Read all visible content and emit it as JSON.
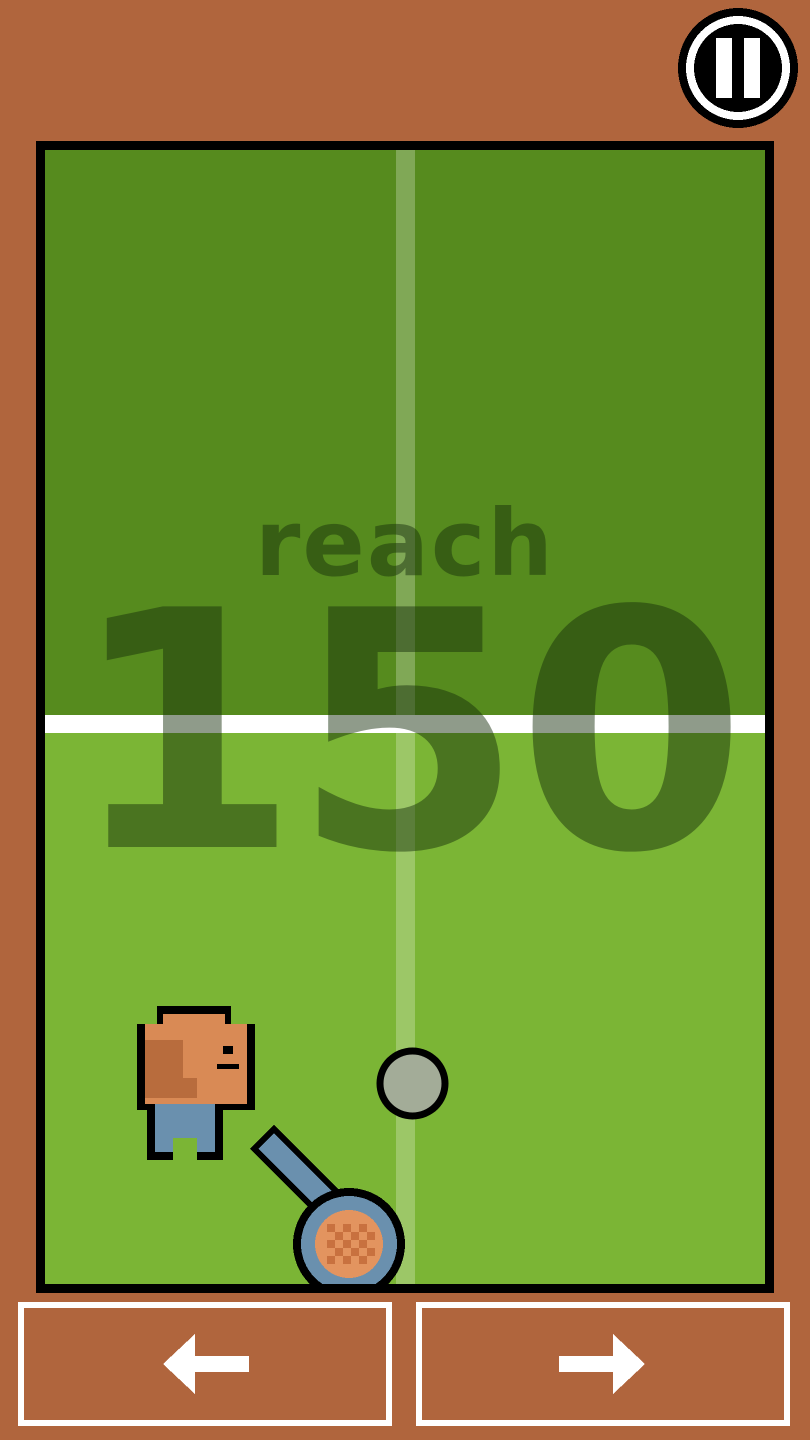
{
  "hud": {
    "goal_prefix": "reach",
    "goal_value": "150"
  },
  "colors": {
    "frame": "#b0653d",
    "court_far": "#568b1e",
    "court_near": "#7bb535",
    "lines": "#ffffff",
    "player_skin": "#d98a55",
    "player_pants": "#6a90ae",
    "ball": "#a3ac98",
    "racket_frame": "#6a90ae",
    "racket_strings": "#e3945f"
  },
  "icons": {
    "pause": "pause-icon",
    "left": "arrow-left-icon",
    "right": "arrow-right-icon"
  }
}
